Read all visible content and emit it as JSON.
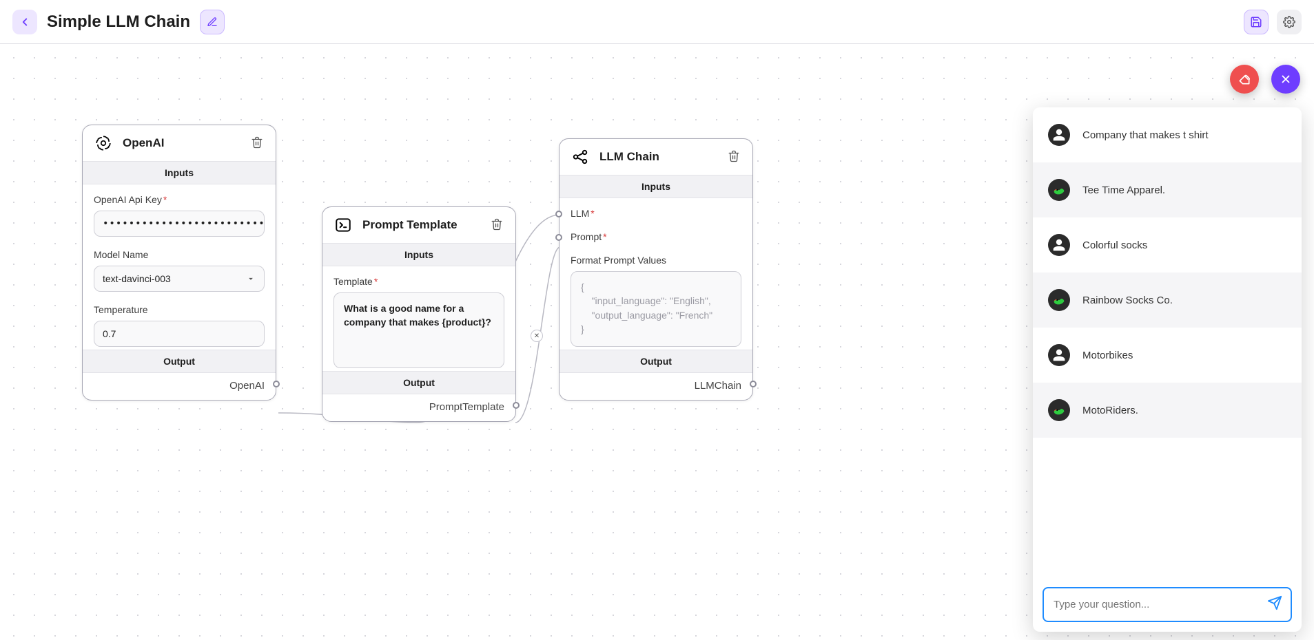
{
  "header": {
    "title": "Simple LLM Chain"
  },
  "nodes": {
    "openai": {
      "title": "OpenAI",
      "inputs_label": "Inputs",
      "output_label": "Output",
      "output_name": "OpenAI",
      "fields": {
        "apikey_label": "OpenAI Api Key",
        "apikey_value": "••••••••••••••••••••••••••••••••••••••••••••••••••",
        "model_label": "Model Name",
        "model_value": "text-davinci-003",
        "temperature_label": "Temperature",
        "temperature_value": "0.7"
      }
    },
    "prompt": {
      "title": "Prompt Template",
      "inputs_label": "Inputs",
      "output_label": "Output",
      "output_name": "PromptTemplate",
      "fields": {
        "template_label": "Template",
        "template_value": "What is a good name for a company that makes {product}?"
      }
    },
    "chain": {
      "title": "LLM Chain",
      "inputs_label": "Inputs",
      "output_label": "Output",
      "output_name": "LLMChain",
      "fields": {
        "llm_label": "LLM",
        "prompt_label": "Prompt",
        "fpv_label": "Format Prompt Values",
        "fpv_placeholder": "{\n    \"input_language\": \"English\",\n    \"output_language\": \"French\"\n}"
      }
    }
  },
  "chat": {
    "messages": [
      {
        "role": "user",
        "text": "Company that makes t shirt"
      },
      {
        "role": "bot",
        "text": "Tee Time Apparel."
      },
      {
        "role": "user",
        "text": "Colorful socks"
      },
      {
        "role": "bot",
        "text": "Rainbow Socks Co."
      },
      {
        "role": "user",
        "text": "Motorbikes"
      },
      {
        "role": "bot",
        "text": "MotoRiders."
      }
    ],
    "input_placeholder": "Type your question..."
  }
}
